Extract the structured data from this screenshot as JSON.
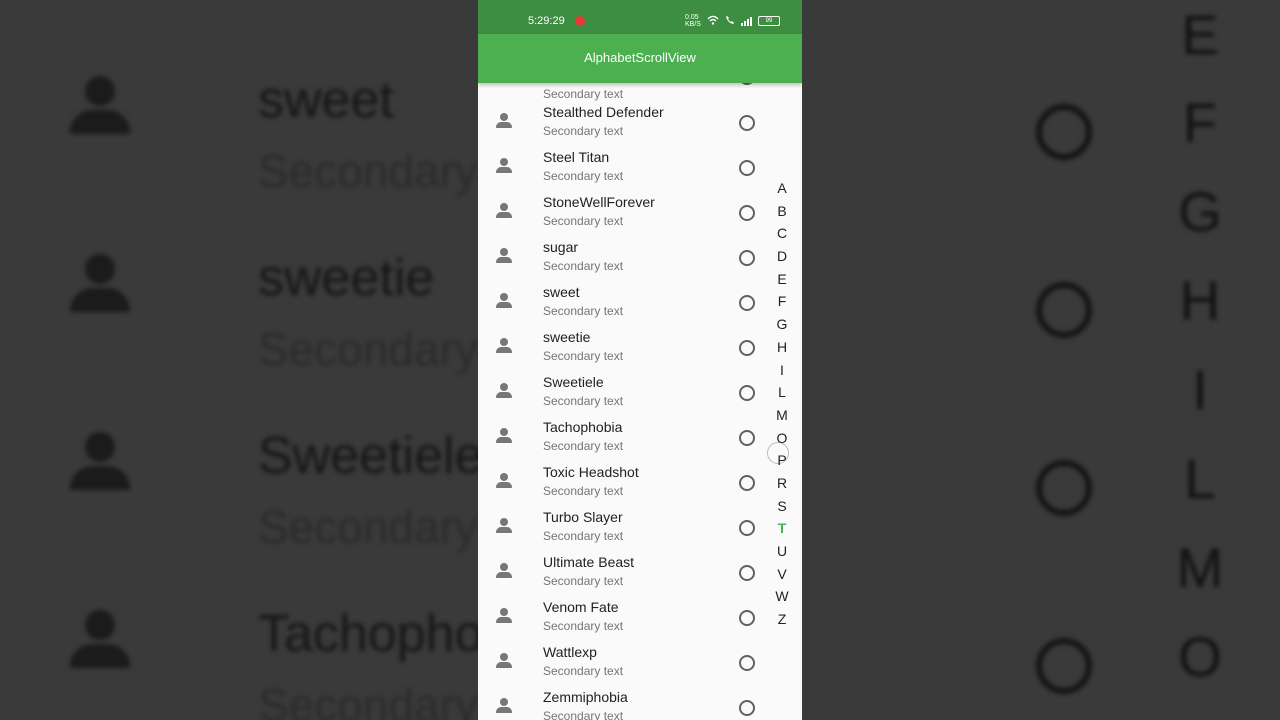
{
  "background": {
    "rows": [
      {
        "title": "sweet",
        "subtitle": "Secondary"
      },
      {
        "title": "sweetie",
        "subtitle": "Secondary"
      },
      {
        "title": "Sweetiele",
        "subtitle": "Secondary"
      },
      {
        "title": "Tachopho",
        "subtitle": "Secondary"
      }
    ],
    "letters": [
      "E",
      "F",
      "G",
      "H",
      "I",
      "L",
      "M",
      "O"
    ]
  },
  "status_bar": {
    "time": "5:29:29",
    "net_speed": "0.05 KB/S",
    "battery": "99"
  },
  "app_bar": {
    "title": "AlphabetScrollView"
  },
  "list": {
    "partial_top_subtitle": "Secondary text",
    "items": [
      {
        "title": "Stealthed Defender",
        "subtitle": "Secondary text"
      },
      {
        "title": "Steel Titan",
        "subtitle": "Secondary text"
      },
      {
        "title": "StoneWellForever",
        "subtitle": "Secondary text"
      },
      {
        "title": "sugar",
        "subtitle": "Secondary text"
      },
      {
        "title": "sweet",
        "subtitle": "Secondary text"
      },
      {
        "title": "sweetie",
        "subtitle": "Secondary text"
      },
      {
        "title": "Sweetiele",
        "subtitle": "Secondary text"
      },
      {
        "title": "Tachophobia",
        "subtitle": "Secondary text"
      },
      {
        "title": "Toxic Headshot",
        "subtitle": "Secondary text"
      },
      {
        "title": "Turbo Slayer",
        "subtitle": "Secondary text"
      },
      {
        "title": "Ultimate Beast",
        "subtitle": "Secondary text"
      },
      {
        "title": "Venom Fate",
        "subtitle": "Secondary text"
      },
      {
        "title": "Wattlexp",
        "subtitle": "Secondary text"
      },
      {
        "title": "Zemmiphobia",
        "subtitle": "Secondary text"
      }
    ]
  },
  "alphabet_index": {
    "letters": [
      "A",
      "B",
      "C",
      "D",
      "E",
      "F",
      "G",
      "H",
      "I",
      "L",
      "M",
      "O",
      "P",
      "R",
      "S",
      "T",
      "U",
      "V",
      "W",
      "Z"
    ],
    "selected": "T"
  },
  "colors": {
    "primary": "#4caf50",
    "status_bar": "#3e8e41",
    "active_letter": "#4caf50"
  },
  "icons": {
    "list_leading": "person-icon",
    "list_trailing": "radio-unchecked-icon"
  }
}
